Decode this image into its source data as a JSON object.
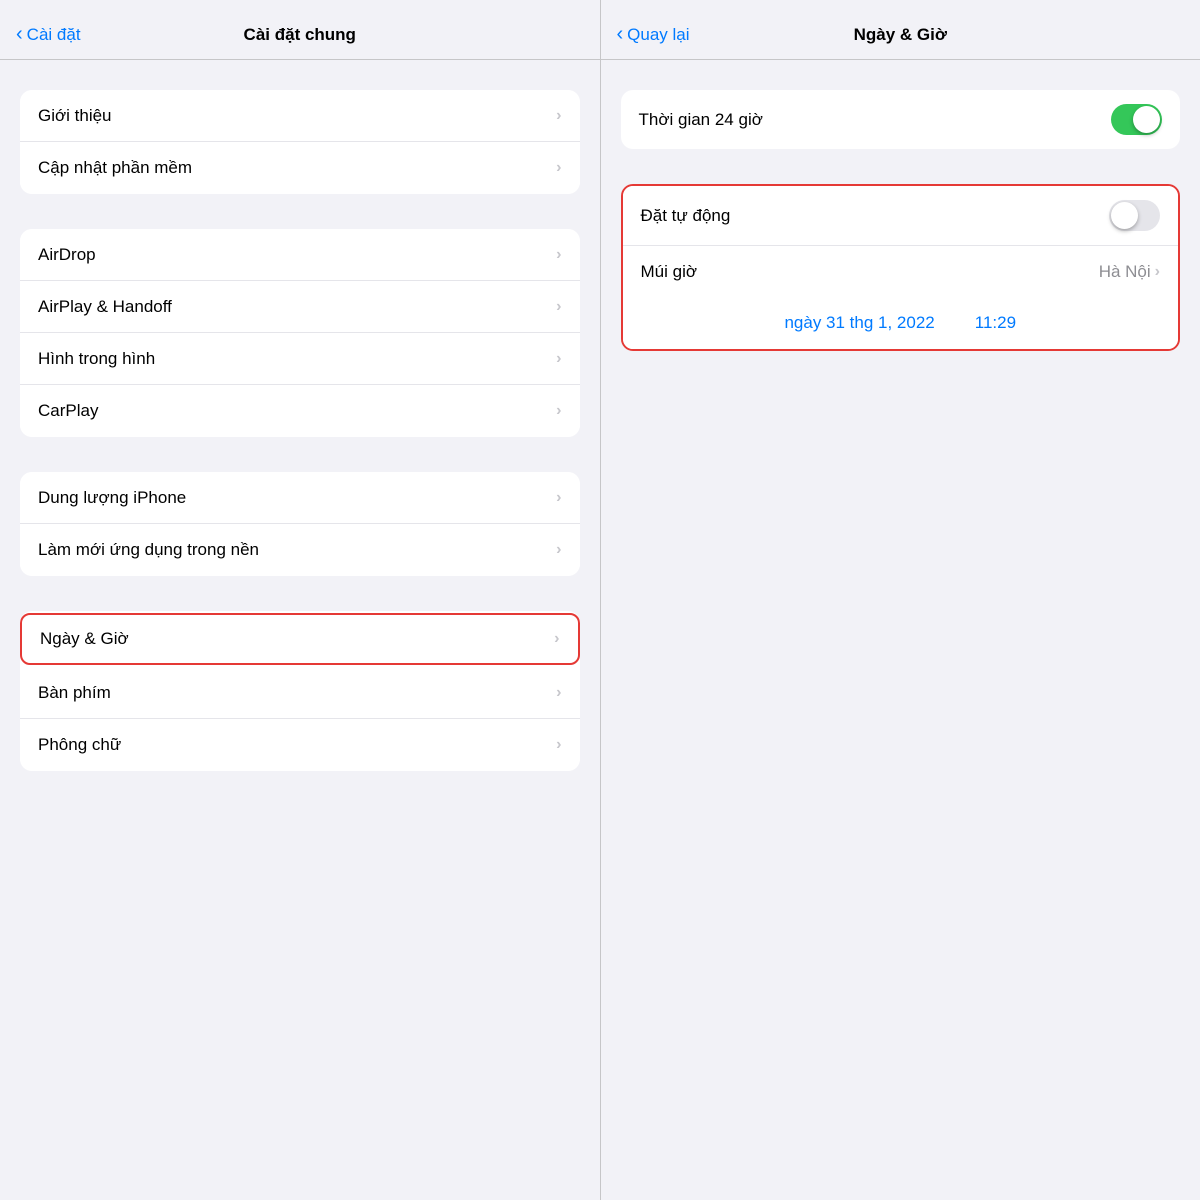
{
  "left_panel": {
    "nav_back_label": "Cài đặt",
    "nav_title": "Cài đặt chung",
    "groups": [
      {
        "id": "group1",
        "items": [
          {
            "id": "gioithieu",
            "label": "Giới thiệu",
            "highlighted": false
          },
          {
            "id": "capnhat",
            "label": "Cập nhật phần mềm",
            "highlighted": false
          }
        ]
      },
      {
        "id": "group2",
        "items": [
          {
            "id": "airdrop",
            "label": "AirDrop",
            "highlighted": false
          },
          {
            "id": "airplay",
            "label": "AirPlay & Handoff",
            "highlighted": false
          },
          {
            "id": "hinhtrong",
            "label": "Hình trong hình",
            "highlighted": false
          },
          {
            "id": "carplay",
            "label": "CarPlay",
            "highlighted": false
          }
        ]
      },
      {
        "id": "group3",
        "items": [
          {
            "id": "dungluo",
            "label": "Dung lượng iPhone",
            "highlighted": false
          },
          {
            "id": "lammoi",
            "label": "Làm mới ứng dụng trong nền",
            "highlighted": false
          }
        ]
      },
      {
        "id": "group4",
        "items": [
          {
            "id": "ngaygio",
            "label": "Ngày & Giờ",
            "highlighted": true
          },
          {
            "id": "banphim",
            "label": "Bàn phím",
            "highlighted": false
          },
          {
            "id": "phongchu",
            "label": "Phông chữ",
            "highlighted": false
          }
        ]
      }
    ]
  },
  "right_panel": {
    "nav_back_label": "Quay lại",
    "nav_title": "Ngày & Giờ",
    "thoigian24h_label": "Thời gian 24 giờ",
    "thoigian24h_on": true,
    "dattudonglabel": "Đặt tự động",
    "dattudong_on": false,
    "muigio_label": "Múi giờ",
    "muigio_value": "Hà Nội",
    "date_value": "ngày 31 thg 1, 2022",
    "time_value": "11:29",
    "highlight_datTuDong": true
  },
  "icons": {
    "chevron": "›",
    "back_chevron": "‹"
  },
  "colors": {
    "accent": "#007aff",
    "highlight_border": "#e53935",
    "toggle_on": "#34c759",
    "toggle_off": "#e5e5ea"
  }
}
